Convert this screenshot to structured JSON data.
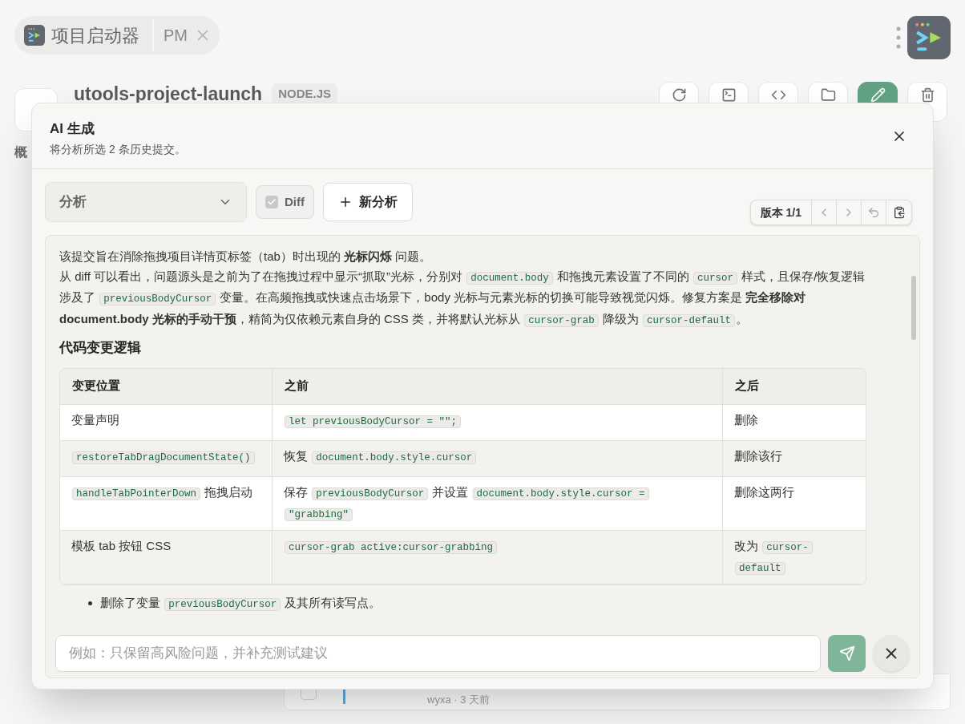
{
  "app_tabs": [
    {
      "kind": "app",
      "label": "项目启动器",
      "selected": true
    },
    {
      "kind": "tab",
      "label": "PM",
      "selected": false
    }
  ],
  "project": {
    "name": "utools-project-launch",
    "badge": "NODE.JS"
  },
  "toolbar": [
    {
      "kind": "refresh",
      "selected": false
    },
    {
      "kind": "terminal",
      "selected": false
    },
    {
      "kind": "code",
      "selected": false
    },
    {
      "kind": "folder",
      "selected": false
    },
    {
      "kind": "edit",
      "selected": true
    },
    {
      "kind": "trash",
      "selected": false
    }
  ],
  "section_tab": "概",
  "commit_meta": "wyxa · 3 天前",
  "commit_checked": false,
  "dialog": {
    "title": "AI 生成",
    "subtitle": "将分析所选 2 条历史提交。",
    "mode_select": "分析",
    "diff_checkbox": {
      "label": "Diff",
      "checked": true,
      "disabled": true
    },
    "new_button": "新分析",
    "version": "版本 1/1",
    "paragraphs": [
      [
        {
          "kind": "text",
          "text": "该提交旨在消除拖拽项目详情页标签（tab）时出现的 **光标闪烁** 问题。"
        }
      ],
      [
        {
          "kind": "text",
          "text": "从 diff 可以看出，问题源头是之前为了在拖拽过程中显示“抓取”光标，分别对 "
        },
        {
          "kind": "code",
          "text": "document.body"
        },
        {
          "kind": "text",
          "text": " 和拖拽元素设置了不同的 "
        },
        {
          "kind": "code",
          "text": "cursor"
        },
        {
          "kind": "text",
          "text": " 样式，且保存/恢复逻辑涉及了 "
        },
        {
          "kind": "code",
          "text": "previousBodyCursor"
        },
        {
          "kind": "text",
          "text": " 变量。在高频拖拽或快速点击场景下，body 光标与元素光标的切换可能导致视觉闪烁。修复方案是 **完全移除对 document.body 光标的手动干预**，精简为仅依赖元素自身的 CSS 类，并将默认光标从 "
        },
        {
          "kind": "code",
          "text": "cursor-grab"
        },
        {
          "kind": "text",
          "text": " 降级为 "
        },
        {
          "kind": "code",
          "text": "cursor-default"
        },
        {
          "kind": "text",
          "text": "。"
        }
      ]
    ],
    "section_heading": "代码变更逻辑",
    "table": {
      "columns": [
        "变更位置",
        "之前",
        "之后"
      ],
      "rows": [
        [
          [
            {
              "kind": "text",
              "text": "变量声明"
            }
          ],
          [
            {
              "kind": "code",
              "text": "let previousBodyCursor = \"\";"
            }
          ],
          [
            {
              "kind": "text",
              "text": "删除"
            }
          ]
        ],
        [
          [
            {
              "kind": "code",
              "text": "restoreTabDragDocumentState()"
            }
          ],
          [
            {
              "kind": "text",
              "text": "恢复 "
            },
            {
              "kind": "code",
              "text": "document.body.style.cursor"
            }
          ],
          [
            {
              "kind": "text",
              "text": "删除该行"
            }
          ]
        ],
        [
          [
            {
              "kind": "code",
              "text": "handleTabPointerDown"
            },
            {
              "kind": "text",
              "text": " 拖拽启动"
            }
          ],
          [
            {
              "kind": "text",
              "text": "保存 "
            },
            {
              "kind": "code",
              "text": "previousBodyCursor"
            },
            {
              "kind": "text",
              "text": " 并设置 "
            },
            {
              "kind": "code",
              "text": "document.body.style.cursor = \"grabbing\""
            }
          ],
          [
            {
              "kind": "text",
              "text": "删除这两行"
            }
          ]
        ],
        [
          [
            {
              "kind": "text",
              "text": "模板 tab 按钮 CSS"
            }
          ],
          [
            {
              "kind": "code",
              "text": "cursor-grab active:cursor-grabbing"
            }
          ],
          [
            {
              "kind": "text",
              "text": "改为 "
            },
            {
              "kind": "code",
              "text": "cursor-default"
            }
          ]
        ]
      ]
    },
    "bullets": [
      [
        {
          "kind": "text",
          "text": "删除了变量 "
        },
        {
          "kind": "code",
          "text": "previousBodyCursor"
        },
        {
          "kind": "text",
          "text": " 及其所有读写点。"
        }
      ]
    ],
    "prompt_placeholder": "例如：只保留高风险问题，并补充测试建议"
  }
}
